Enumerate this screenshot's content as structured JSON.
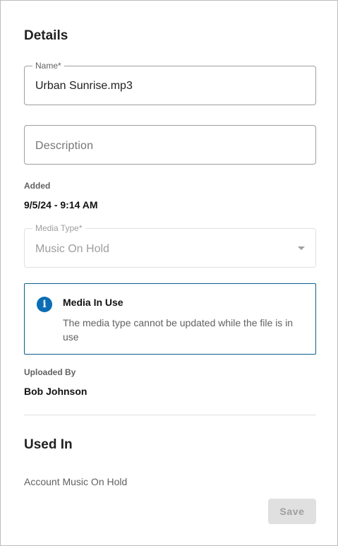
{
  "details": {
    "title": "Details",
    "name_field": {
      "label": "Name*",
      "value": "Urban Sunrise.mp3"
    },
    "description_field": {
      "placeholder": "Description",
      "value": ""
    },
    "added": {
      "label": "Added",
      "value": "9/5/24 - 9:14 AM"
    },
    "media_type_field": {
      "label": "Media Type*",
      "value": "Music On Hold",
      "disabled": true
    },
    "alert": {
      "icon": "info-icon",
      "title": "Media In Use",
      "message": "The media type cannot be updated while the file is in use"
    },
    "uploaded_by": {
      "label": "Uploaded By",
      "value": "Bob Johnson"
    }
  },
  "used_in": {
    "title": "Used In",
    "items": [
      "Account Music On Hold"
    ]
  },
  "actions": {
    "save_label": "Save",
    "save_disabled": true
  },
  "colors": {
    "info_blue": "#0b6db5",
    "alert_border": "#0b5e8e",
    "disabled_bg": "#e0e0e0",
    "disabled_text": "#9e9e9e"
  }
}
